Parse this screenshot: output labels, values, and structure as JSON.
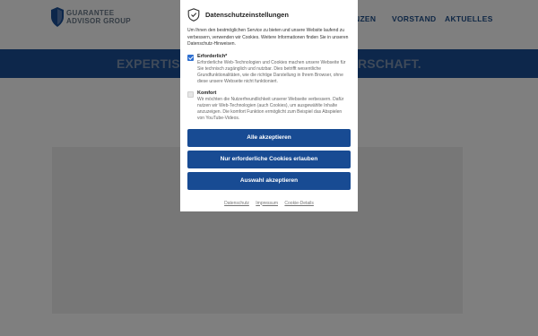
{
  "site": {
    "logo_line1": "GUARANTEE",
    "logo_line2": "ADVISOR GROUP",
    "nav": [
      "NZEN",
      "VORSTAND",
      "AKTUELLES"
    ],
    "banner_left": "EXPERTIS",
    "banner_right": "RSCHAFT."
  },
  "consent": {
    "title": "Datenschutzeinstellungen",
    "intro": "Um Ihnen den bestmöglichen Service zu bieten und unsere Website laufend zu verbessern, verwenden wir Cookies. Weitere Informationen finden Sie in unseren Datenschutz-Hinweisen.",
    "options": [
      {
        "title": "Erforderlich*",
        "checked": true,
        "desc": "Erforderliche Web-Technologien und Cookies machen unsere Webseite für Sie technisch zugänglich und nutzbar. Dies betrifft wesentliche Grundfunktionalitäten, wie die richtige Darstellung in Ihrem Browser, ohne diese unsere Webseite nicht funktioniert."
      },
      {
        "title": "Komfort",
        "checked": false,
        "desc": "Wir möchten die Nutzerfreundlichkeit unserer Webseite verbessern. Dafür nutzen wir Web-Technologien (auch Cookies), um ausgewählte Inhalte anzuzeigen. Die komfort Funktion ermöglicht zum Beispiel das Abspielen von YouTube-Videos."
      }
    ],
    "buttons": {
      "accept_all": "Alle akzeptieren",
      "required_only": "Nur erforderliche Cookies erlauben",
      "accept_selection": "Auswahl akzeptieren"
    },
    "links": {
      "privacy": "Datenschutz",
      "imprint": "Impressum",
      "cookie_details": "Cookie-Details"
    }
  },
  "colors": {
    "brand_blue": "#184b93",
    "banner_blue": "#1a4f96",
    "checkbox_blue": "#2e6fd0"
  }
}
